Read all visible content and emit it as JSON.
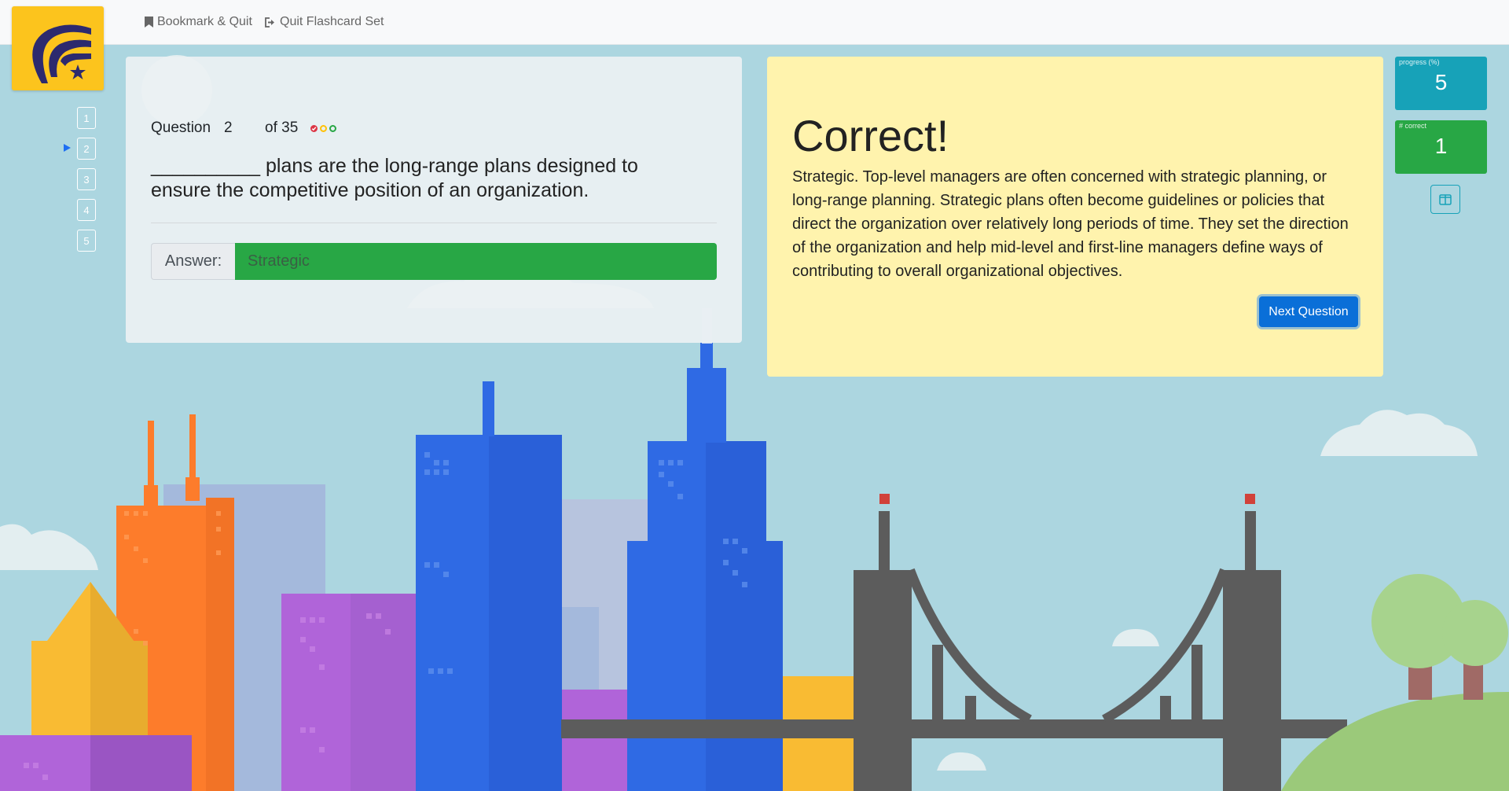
{
  "nav": {
    "bookmark_label": "Bookmark & Quit",
    "quit_label": "Quit Flashcard Set"
  },
  "question_nav": {
    "items": [
      "1",
      "2",
      "3",
      "4",
      "5"
    ],
    "current": "2"
  },
  "question": {
    "label": "Question",
    "number": "2",
    "of_total": "of 35",
    "status_dots": [
      {
        "state": "correct",
        "color": "#dc3545"
      },
      {
        "state": "pending",
        "color": "#ffc107"
      },
      {
        "state": "pending",
        "color": "#28a745"
      }
    ],
    "text": "__________ plans are the long-range plans designed to ensure the competitive position of an organization.",
    "answer_label": "Answer:",
    "answer_value": "Strategic"
  },
  "feedback": {
    "title": "Correct!",
    "body": "Strategic. Top-level managers are often concerned with strategic planning, or long-range planning. Strategic plans often become guidelines or policies that direct the organization over relatively long periods of time. They set the direction of the organization and help mid-level and first-line managers define ways of contributing to overall organizational objectives.",
    "next_label": "Next Question"
  },
  "stats": {
    "progress_label": "progress (%)",
    "progress_value": "5",
    "correct_label": "# correct",
    "correct_value": "1"
  },
  "colors": {
    "sky": "#acd6e0",
    "logo": "#fcc41d",
    "feedback_bg": "#fff3ad",
    "success": "#28a745",
    "info": "#17a2b8",
    "primary": "#0a6fd8"
  },
  "icons": {
    "logo": "wing-star-logo",
    "bookmark": "bookmark-icon",
    "quit": "sign-out-icon",
    "layout": "columns-icon"
  }
}
